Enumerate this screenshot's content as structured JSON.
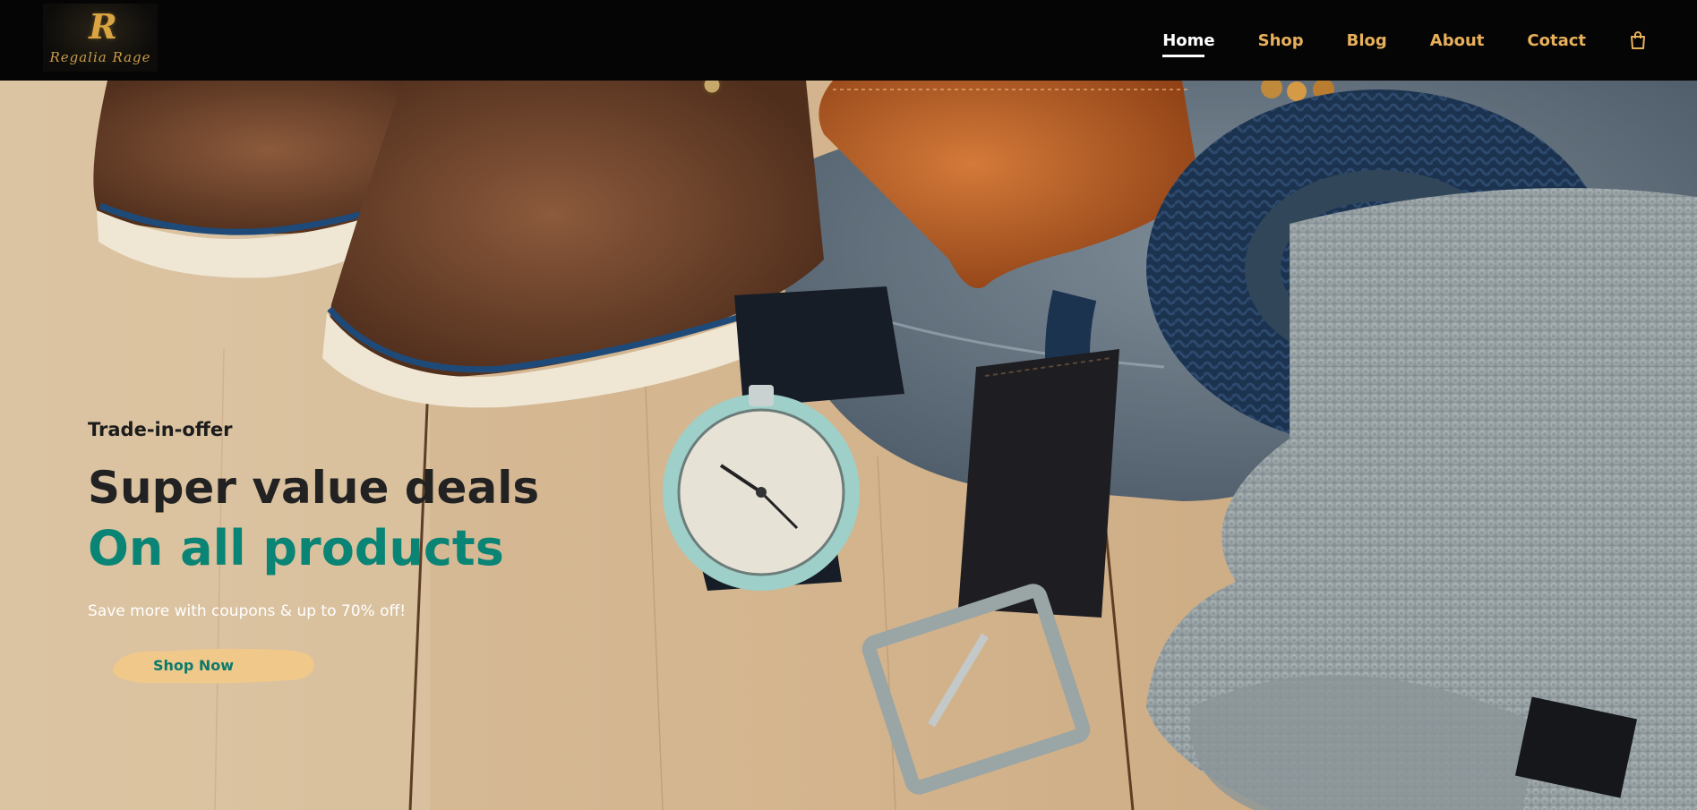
{
  "brand": {
    "logo_mark": "R",
    "logo_text": "Regalia Rage"
  },
  "nav": {
    "items": [
      {
        "label": "Home",
        "active": true
      },
      {
        "label": "Shop",
        "active": false
      },
      {
        "label": "Blog",
        "active": false
      },
      {
        "label": "About",
        "active": false
      },
      {
        "label": "Cotact",
        "active": false
      }
    ],
    "cart_icon": "shopping-bag-icon"
  },
  "hero": {
    "eyebrow": "Trade-in-offer",
    "headline": "Super value deals",
    "subheadline": "On all products",
    "description": "Save more with coupons & up to 70% off!",
    "cta_label": "Shop Now",
    "image_subject": "shoes, wallet, watch, belts, jeans and sweater on wooden floor"
  },
  "colors": {
    "header_bg": "#050505",
    "nav_link": "#e8b05a",
    "nav_active": "#ffffff",
    "accent_teal": "#0a8474",
    "cta_brush": "#f0c98a"
  }
}
